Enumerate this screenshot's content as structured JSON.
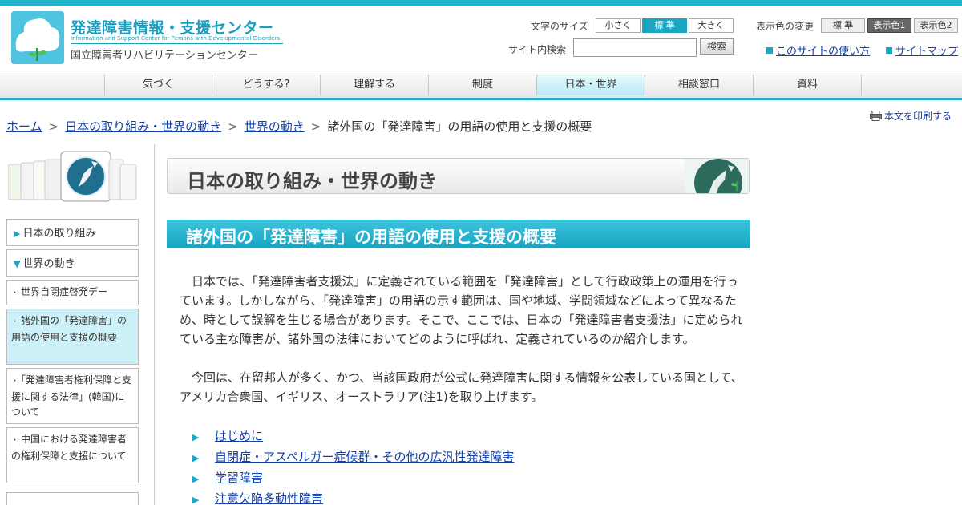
{
  "header": {
    "title": "発達障害情報・支援センター",
    "subtitle_en": "Information and Support Center for Persons with Developmental Disorders",
    "org": "国立障害者リハビリテーションセンター"
  },
  "tools": {
    "font_size_label": "文字のサイズ",
    "font_sizes": [
      "小さく",
      "標 準",
      "大きく"
    ],
    "color_label": "表示色の変更",
    "colors": [
      "標 準",
      "表示色1",
      "表示色2"
    ],
    "search_label": "サイト内検索",
    "search_value": "",
    "search_button": "検索",
    "links": [
      "このサイトの使い方",
      "サイトマップ"
    ]
  },
  "nav": {
    "items": [
      "気づく",
      "どうする?",
      "理解する",
      "制度",
      "日本・世界",
      "相談窓口",
      "資料"
    ],
    "active": "日本・世界"
  },
  "breadcrumb": {
    "items": [
      "ホーム",
      "日本の取り組み・世界の動き",
      "世界の動き"
    ],
    "current": "諸外国の「発達障害」の用語の使用と支援の概要",
    "sep": ">"
  },
  "print_label": "本文を印刷する",
  "sidebar": {
    "items": [
      "日本の取り組み",
      "世界の動き",
      "世界自閉症啓発デー",
      "諸外国の「発達障害」の用語の使用と支援の概要",
      "「発達障害者権利保障と支援に関する法律」(韓国)について",
      "中国における発達障害者の権利保障と支援について"
    ]
  },
  "main": {
    "section_title": "日本の取り組み・世界の動き",
    "page_title": "諸外国の「発達障害」の用語の使用と支援の概要",
    "paragraph1": "日本では、「発達障害者支援法」に定義されている範囲を「発達障害」として行政政策上の運用を行っています。しかしながら、「発達障害」の用語の示す範囲は、国や地域、学問領域などによって異なるため、時として誤解を生じる場合があります。そこで、ここでは、日本の「発達障害者支援法」に定められている主な障害が、諸外国の法律においてどのように呼ばれ、定義されているのか紹介します。",
    "paragraph2": "今回は、在留邦人が多く、かつ、当該国政府が公式に発達障害に関する情報を公表している国として、アメリカ合衆国、イギリス、オーストラリア(注1)を取り上げます。",
    "toc": [
      "はじめに",
      "自閉症・アスペルガー症候群・その他の広汎性発達障害",
      "学習障害",
      "注意欠陥多動性障害"
    ]
  },
  "colors": {
    "accent": "#1eb5c9",
    "link": "#1240a8"
  }
}
